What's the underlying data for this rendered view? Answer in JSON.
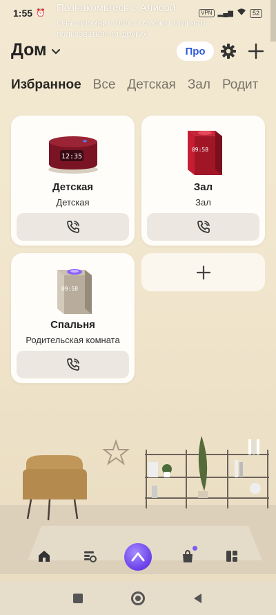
{
  "status_bar": {
    "time": "1:55",
    "notification_title": "Познакомьтесь с Алисой",
    "notification_text": "Она запомнит голос и сможет отличать пользователя от других",
    "vpn": "VPN",
    "battery": "52"
  },
  "header": {
    "title": "Дом",
    "pro_label": "Про"
  },
  "tabs": [
    {
      "label": "Избранное",
      "active": true
    },
    {
      "label": "Все"
    },
    {
      "label": "Детская"
    },
    {
      "label": "Зал"
    },
    {
      "label": "Родит"
    }
  ],
  "devices": [
    {
      "name": "Детская",
      "room": "Детская",
      "clock": "12:35"
    },
    {
      "name": "Зал",
      "room": "Зал",
      "clock": "09:58"
    },
    {
      "name": "Спальня",
      "room": "Родительская комната",
      "clock": "09:58"
    }
  ],
  "colors": {
    "accent": "#2f59d5",
    "alice": "#6a3fe8",
    "background": "#f1e6cd"
  }
}
